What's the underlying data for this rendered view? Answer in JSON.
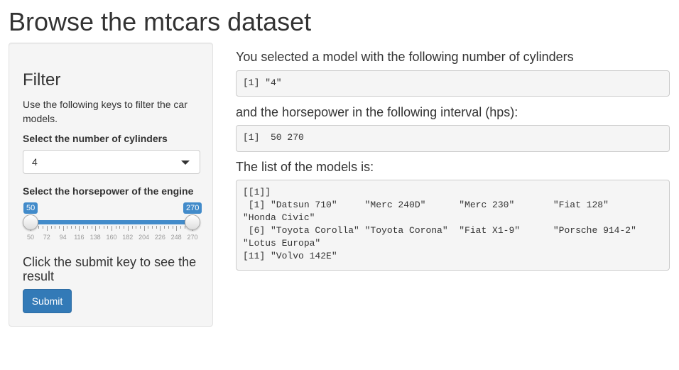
{
  "page": {
    "title": "Browse the mtcars dataset"
  },
  "sidebar": {
    "heading": "Filter",
    "description": "Use the following keys to filter the car models.",
    "cylinders": {
      "label": "Select the number of cylinders",
      "selected": "4"
    },
    "horsepower": {
      "label": "Select the horsepower of the engine",
      "min": 50,
      "max": 270,
      "from": 50,
      "to": 270,
      "from_label": "50",
      "to_label": "270",
      "tick_labels": [
        "50",
        "72",
        "94",
        "116",
        "138",
        "160",
        "182",
        "204",
        "226",
        "248",
        "270"
      ]
    },
    "submit_prompt": "Click the submit key to see the result",
    "submit_label": "Submit"
  },
  "main": {
    "cylinders_label": "You selected a model with the following number of cylinders",
    "cylinders_output": "[1] \"4\"",
    "hp_label": "and the horsepower in the following interval (hps):",
    "hp_output": "[1]  50 270",
    "models_label": "The list of the models is:",
    "models_output": "[[1]]\n [1] \"Datsun 710\"     \"Merc 240D\"      \"Merc 230\"       \"Fiat 128\"      \n\"Honda Civic\"\n [6] \"Toyota Corolla\" \"Toyota Corona\"  \"Fiat X1-9\"      \"Porsche 914-2\" \n\"Lotus Europa\"\n[11] \"Volvo 142E\""
  },
  "colors": {
    "accent": "#428bca",
    "button": "#337ab7",
    "well_bg": "#f5f5f5"
  }
}
